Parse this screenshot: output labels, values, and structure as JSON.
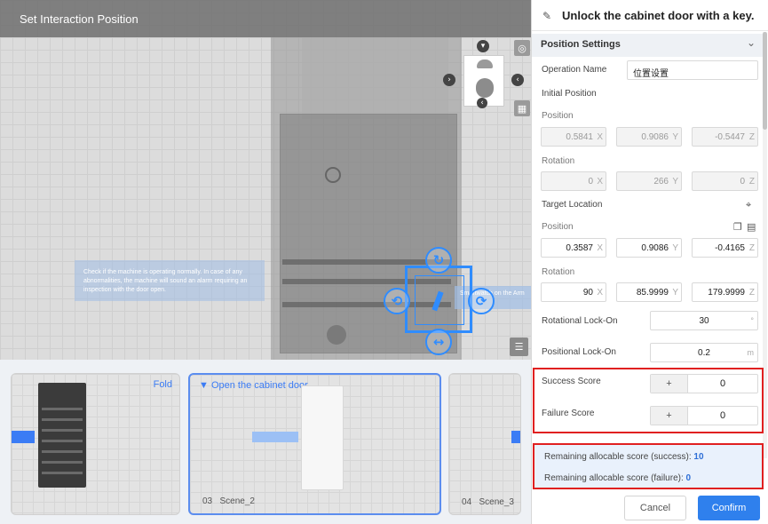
{
  "viewport": {
    "title": "Set Interaction Position",
    "info_text": "Check if the machine is operating normally. In case of any abnormalities, the machine will sound an alarm requiring an inspection with the door open.",
    "info_text_2": "Smartwatch on the Arm"
  },
  "scenes": [
    {
      "label": "Fold",
      "number": ""
    },
    {
      "label": "Open the cabinet door",
      "number": "03",
      "name": "Scene_2"
    },
    {
      "label": "",
      "number": "04",
      "name": "Scene_3"
    }
  ],
  "panel": {
    "title": "Unlock the cabinet door with a key.",
    "section": "Position Settings",
    "operation_name_label": "Operation Name",
    "operation_name_value": "位置设置",
    "initial_position_label": "Initial Position",
    "position_label": "Position",
    "rotation_label": "Rotation",
    "initial_position": {
      "x": "0.5841",
      "y": "0.9086",
      "z": "-0.5447"
    },
    "initial_rotation": {
      "x": "0",
      "y": "266",
      "z": "0"
    },
    "target_location_label": "Target Location",
    "target_position": {
      "x": "0.3587",
      "y": "0.9086",
      "z": "-0.4165"
    },
    "target_rotation": {
      "x": "90",
      "y": "85.9999",
      "z": "179.9999"
    },
    "axis": {
      "x": "X",
      "y": "Y",
      "z": "Z"
    },
    "rotational_lock_label": "Rotational Lock-On",
    "rotational_lock_value": "30",
    "rotational_lock_unit": "°",
    "positional_lock_label": "Positional Lock-On",
    "positional_lock_value": "0.2",
    "positional_lock_unit": "m",
    "success_score_label": "Success Score",
    "success_score_value": "0",
    "failure_score_label": "Failure Score",
    "failure_score_value": "0",
    "plus_label": "+",
    "remaining_success_label": "Remaining allocable score (success):",
    "remaining_success_value": "10",
    "remaining_failure_label": "Remaining allocable score (failure):",
    "remaining_failure_value": "0",
    "cancel_label": "Cancel",
    "confirm_label": "Confirm"
  },
  "icons": {
    "edit": "pencil-icon",
    "collapse": "chevron-down-icon",
    "locate": "crosshair-icon",
    "copy": "copy-icon",
    "paste": "paste-icon"
  },
  "colors": {
    "accent": "#2f80ed",
    "highlight": "#e02020",
    "remaining_bg": "#e9f1fc"
  }
}
